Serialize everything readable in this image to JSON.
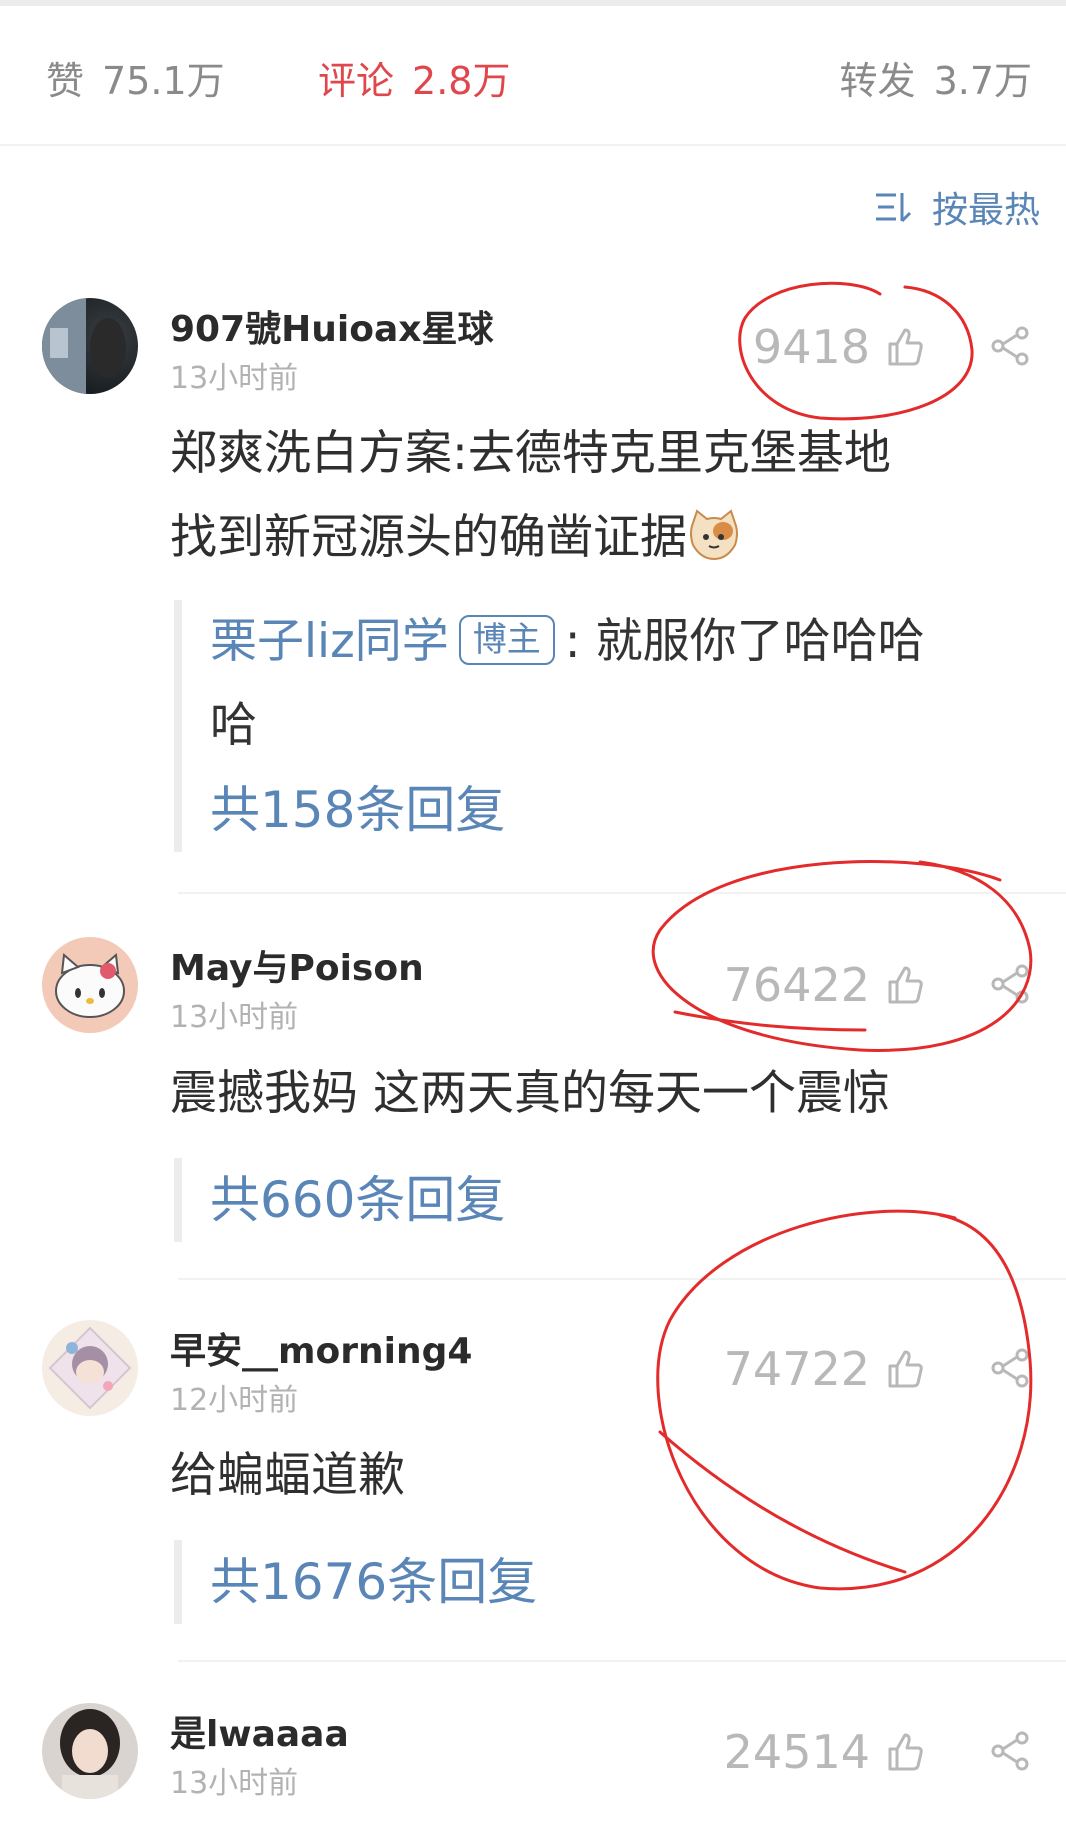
{
  "stats": {
    "like_label": "赞",
    "like_value": "75.1万",
    "comment_label": "评论",
    "comment_value": "2.8万",
    "repost_label": "转发",
    "repost_value": "3.7万"
  },
  "sort": {
    "label": "按最热",
    "icon": "sort-icon"
  },
  "colors": {
    "accent_red": "#e0474c",
    "link_blue": "#5a86b7",
    "annotation_red": "#e32b2b"
  },
  "comments": [
    {
      "user": "907號Huioax星球",
      "time": "13小时前",
      "likes": "9418",
      "text_line1": "郑爽洗白方案:去德特克里克堡基地",
      "text_line2": "找到新冠源头的确凿证据",
      "emoji": "cat-face-emoji",
      "reply": {
        "user": "栗子liz同学",
        "badge": "博主",
        "separator": ":",
        "text_line1": "就服你了哈哈哈",
        "text_line2": "哈"
      },
      "reply_count": "共158条回复"
    },
    {
      "user": "May与Poison",
      "time": "13小时前",
      "likes": "76422",
      "text_line1": "震撼我妈 这两天真的每天一个震惊",
      "reply_count": "共660条回复"
    },
    {
      "user": "早安__morning4",
      "time": "12小时前",
      "likes": "74722",
      "text_line1": "给蝙蝠道歉",
      "reply_count": "共1676条回复"
    },
    {
      "user": "是lwaaaa",
      "time": "13小时前",
      "likes": "24514"
    }
  ]
}
